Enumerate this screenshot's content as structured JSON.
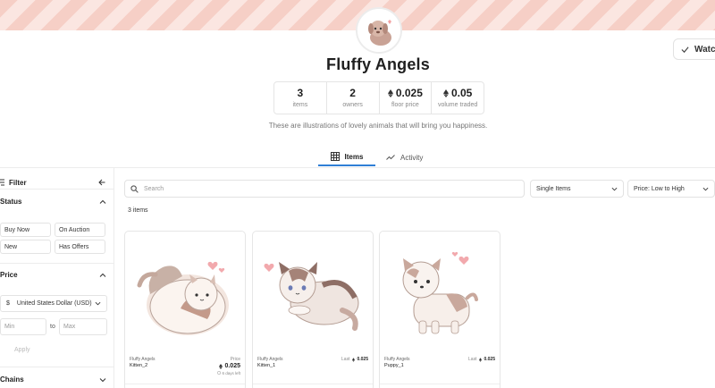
{
  "collection": {
    "name": "Fluffy Angels",
    "description": "These are illustrations of lovely animals that will bring you happiness.",
    "watch_label": "Watchi"
  },
  "stats": [
    {
      "value": "3",
      "label": "items",
      "eth": false
    },
    {
      "value": "2",
      "label": "owners",
      "eth": false
    },
    {
      "value": "0.025",
      "label": "floor price",
      "eth": true
    },
    {
      "value": "0.05",
      "label": "volume traded",
      "eth": true
    }
  ],
  "tabs": [
    {
      "label": "Items",
      "icon": "grid-icon",
      "active": true
    },
    {
      "label": "Activity",
      "icon": "trend-icon",
      "active": false
    }
  ],
  "sidebar": {
    "filter_label": "Filter",
    "status": {
      "title": "Status",
      "chips": [
        "Buy Now",
        "On Auction",
        "New",
        "Has Offers"
      ]
    },
    "price": {
      "title": "Price",
      "currency_symbol": "$",
      "currency": "United States Dollar (USD)",
      "min_placeholder": "Min",
      "max_placeholder": "Max",
      "to_label": "to",
      "apply_label": "Apply"
    },
    "chains": {
      "title": "Chains"
    }
  },
  "toolbar": {
    "search_placeholder": "Search",
    "type_select": "Single Items",
    "sort_select": "Price: Low to High",
    "items_count": "3 items"
  },
  "items": [
    {
      "collection": "Fluffy Angels",
      "name": "Kitten_2",
      "price_label": "Price",
      "price": "0.025",
      "days_left": "6 days left",
      "kind": "listed"
    },
    {
      "collection": "Fluffy Angels",
      "name": "Kitten_1",
      "last_label": "Last",
      "last_price": "0.025",
      "kind": "last"
    },
    {
      "collection": "Fluffy Angels",
      "name": "Puppy_1",
      "last_label": "Last",
      "last_price": "0.025",
      "kind": "last"
    }
  ],
  "colors": {
    "accent": "#2f7fd6",
    "banner_stripe_a": "#f6cfc6",
    "banner_stripe_b": "#fbe6e1"
  }
}
